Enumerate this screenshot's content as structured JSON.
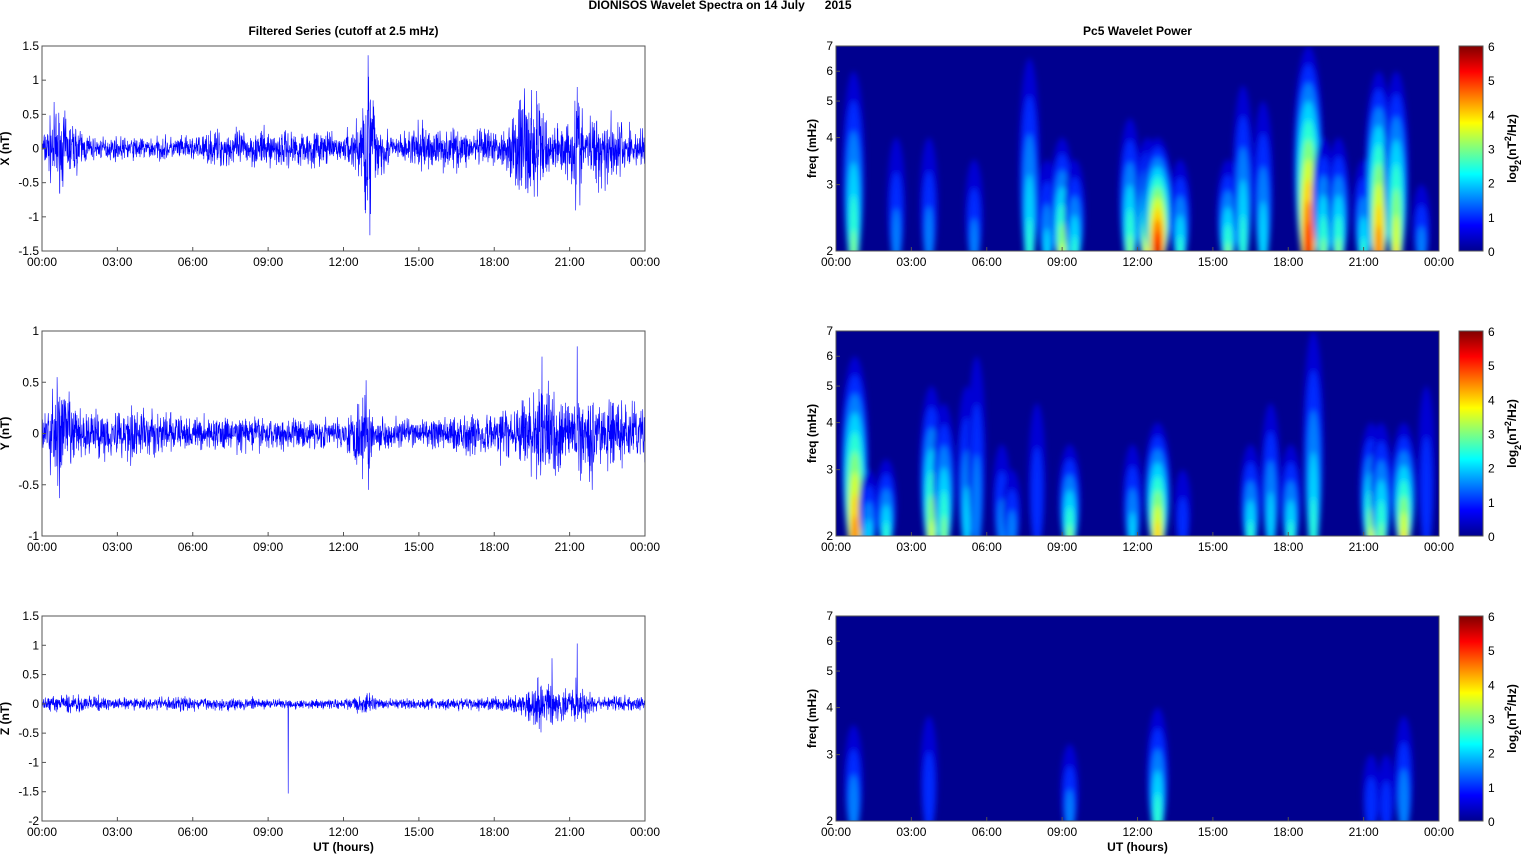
{
  "title": "DIONISOS Wavelet Spectra on 14 July      2015",
  "colors": {
    "trace": "#0000ff",
    "spec_background": "#00008f"
  },
  "chart_data": [
    {
      "type": "line",
      "panel": "X",
      "title": "Filtered Series (cutoff at 2.5 mHz)",
      "ylabel": "X (nT)",
      "xlabel": "",
      "ylim": [
        -1.5,
        1.5
      ],
      "yticks": [
        "-1.5",
        "-1",
        "-0.5",
        "0",
        "0.5",
        "1",
        "1.5"
      ],
      "xticks": [
        "00:00",
        "03:00",
        "06:00",
        "09:00",
        "12:00",
        "15:00",
        "18:00",
        "21:00",
        "00:00"
      ],
      "envelope": [
        [
          0,
          0.12
        ],
        [
          0.5,
          0.45
        ],
        [
          1.2,
          0.3
        ],
        [
          2,
          0.12
        ],
        [
          6,
          0.13
        ],
        [
          7,
          0.2
        ],
        [
          11,
          0.2
        ],
        [
          12,
          0.12
        ],
        [
          12.8,
          0.5
        ],
        [
          13,
          1.1
        ],
        [
          13.3,
          0.4
        ],
        [
          14,
          0.12
        ],
        [
          15,
          0.25
        ],
        [
          17,
          0.2
        ],
        [
          18.5,
          0.2
        ],
        [
          19,
          0.6
        ],
        [
          19.5,
          0.7
        ],
        [
          20.3,
          0.25
        ],
        [
          21,
          0.3
        ],
        [
          21.3,
          0.75
        ],
        [
          21.6,
          0.3
        ],
        [
          22.3,
          0.45
        ],
        [
          23,
          0.3
        ],
        [
          24,
          0.2
        ]
      ],
      "spikes": [
        [
          13.0,
          1.05
        ],
        [
          13.05,
          -1.27
        ],
        [
          19.2,
          0.88
        ],
        [
          21.3,
          0.9
        ]
      ]
    },
    {
      "type": "heatmap",
      "panel": "X",
      "title": "Pc5 Wavelet Power",
      "ylabel": "freq (mHz)",
      "colorbar_label": "log2(nT2/Hz)",
      "clim": [
        0,
        6
      ],
      "ylim": [
        2,
        7
      ],
      "yticks": [
        "2",
        "3",
        "4",
        "5",
        "6",
        "7"
      ],
      "cticks": [
        "0",
        "1",
        "2",
        "3",
        "4",
        "5",
        "6"
      ],
      "xticks": [
        "00:00",
        "03:00",
        "06:00",
        "09:00",
        "12:00",
        "15:00",
        "18:00",
        "21:00",
        "00:00"
      ],
      "blobs": [
        [
          0.7,
          2.7,
          3,
          6
        ],
        [
          2.4,
          2.6,
          1.5,
          4
        ],
        [
          3.7,
          2.8,
          1.5,
          4
        ],
        [
          5.5,
          2.4,
          1.5,
          3.5
        ],
        [
          7.7,
          2.7,
          2.5,
          6.5
        ],
        [
          8.4,
          2.5,
          2,
          3.5
        ],
        [
          9.0,
          2.6,
          3.5,
          4
        ],
        [
          9.5,
          2.5,
          2.5,
          3.5
        ],
        [
          11.7,
          2.7,
          3,
          4.5
        ],
        [
          12.4,
          2.5,
          4,
          4
        ],
        [
          12.8,
          2.6,
          6,
          4
        ],
        [
          13.7,
          2.5,
          2.5,
          3.5
        ],
        [
          15.6,
          2.4,
          3,
          3.5
        ],
        [
          16.2,
          3.3,
          2.5,
          5.5
        ],
        [
          17.0,
          2.8,
          2.2,
          5
        ],
        [
          18.8,
          2.7,
          5.8,
          7
        ],
        [
          19.4,
          2.6,
          3,
          4
        ],
        [
          20.0,
          2.6,
          3,
          4
        ],
        [
          21.0,
          2.4,
          2.5,
          3.5
        ],
        [
          21.6,
          3.0,
          5,
          6
        ],
        [
          22.3,
          2.8,
          4,
          6
        ],
        [
          23.3,
          2.5,
          1.5,
          3
        ]
      ]
    },
    {
      "type": "line",
      "panel": "Y",
      "title": "",
      "ylabel": "Y (nT)",
      "ylim": [
        -1,
        1
      ],
      "yticks": [
        "-1",
        "-0.5",
        "0",
        "0.5",
        "1"
      ],
      "xticks": [
        "00:00",
        "03:00",
        "06:00",
        "09:00",
        "12:00",
        "15:00",
        "18:00",
        "21:00",
        "00:00"
      ],
      "envelope": [
        [
          0,
          0.12
        ],
        [
          0.5,
          0.4
        ],
        [
          1,
          0.35
        ],
        [
          1.5,
          0.15
        ],
        [
          2.5,
          0.2
        ],
        [
          4,
          0.18
        ],
        [
          6,
          0.12
        ],
        [
          9,
          0.12
        ],
        [
          12,
          0.1
        ],
        [
          12.8,
          0.35
        ],
        [
          13.2,
          0.12
        ],
        [
          15,
          0.1
        ],
        [
          17,
          0.15
        ],
        [
          19,
          0.2
        ],
        [
          20,
          0.35
        ],
        [
          20.5,
          0.3
        ],
        [
          21,
          0.2
        ],
        [
          21.5,
          0.3
        ],
        [
          22.5,
          0.25
        ],
        [
          24,
          0.2
        ]
      ],
      "spikes": [
        [
          0.6,
          0.55
        ],
        [
          0.7,
          -0.63
        ],
        [
          12.9,
          0.52
        ],
        [
          13.0,
          -0.55
        ],
        [
          19.9,
          0.75
        ],
        [
          21.3,
          0.85
        ],
        [
          21.9,
          -0.55
        ]
      ]
    },
    {
      "type": "heatmap",
      "panel": "Y",
      "ylabel": "freq (mHz)",
      "colorbar_label": "log2(nT2/Hz)",
      "clim": [
        0,
        6
      ],
      "ylim": [
        2,
        7
      ],
      "yticks": [
        "2",
        "3",
        "4",
        "5",
        "6",
        "7"
      ],
      "cticks": [
        "0",
        "1",
        "2",
        "3",
        "4",
        "5",
        "6"
      ],
      "xticks": [
        "00:00",
        "03:00",
        "06:00",
        "09:00",
        "12:00",
        "15:00",
        "18:00",
        "21:00",
        "00:00"
      ],
      "blobs": [
        [
          0.75,
          2.6,
          5,
          6
        ],
        [
          1.3,
          2.5,
          2,
          3
        ],
        [
          2.0,
          2.6,
          2.5,
          3.2
        ],
        [
          3.8,
          3.0,
          3.5,
          5
        ],
        [
          4.3,
          3.0,
          3,
          4.5
        ],
        [
          5.2,
          3.8,
          2,
          5
        ],
        [
          5.6,
          4.6,
          1.5,
          6
        ],
        [
          6.6,
          2.8,
          1.5,
          3.5
        ],
        [
          7.0,
          2.6,
          1.5,
          3
        ],
        [
          8.0,
          3.6,
          1.2,
          4.5
        ],
        [
          9.3,
          2.6,
          3,
          3.5
        ],
        [
          11.8,
          2.6,
          2,
          3.5
        ],
        [
          12.8,
          2.4,
          4.5,
          4
        ],
        [
          13.8,
          2.6,
          1,
          3
        ],
        [
          16.5,
          2.5,
          2.5,
          3.5
        ],
        [
          17.3,
          3.6,
          2,
          4.5
        ],
        [
          18.1,
          2.5,
          2.5,
          3.5
        ],
        [
          19.0,
          3.0,
          2.5,
          7
        ],
        [
          21.3,
          2.6,
          3.5,
          4
        ],
        [
          21.7,
          2.6,
          3,
          4
        ],
        [
          22.6,
          2.7,
          4,
          4
        ],
        [
          23.5,
          3.6,
          1.2,
          5
        ]
      ]
    },
    {
      "type": "line",
      "panel": "Z",
      "title": "",
      "ylabel": "Z (nT)",
      "xlabel": "UT (hours)",
      "ylim": [
        -2,
        1.5
      ],
      "yticks": [
        "-2",
        "-1.5",
        "-1",
        "-0.5",
        "0",
        "0.5",
        "1",
        "1.5"
      ],
      "xticks": [
        "00:00",
        "03:00",
        "06:00",
        "09:00",
        "12:00",
        "15:00",
        "18:00",
        "21:00",
        "00:00"
      ],
      "envelope": [
        [
          0,
          0.08
        ],
        [
          1,
          0.12
        ],
        [
          3,
          0.07
        ],
        [
          6,
          0.09
        ],
        [
          9,
          0.07
        ],
        [
          12,
          0.06
        ],
        [
          13,
          0.15
        ],
        [
          13.5,
          0.06
        ],
        [
          18,
          0.08
        ],
        [
          19,
          0.12
        ],
        [
          19.8,
          0.3
        ],
        [
          20.5,
          0.25
        ],
        [
          21,
          0.15
        ],
        [
          21.3,
          0.3
        ],
        [
          22,
          0.1
        ],
        [
          24,
          0.08
        ]
      ],
      "spikes": [
        [
          9.8,
          -1.53
        ],
        [
          20.3,
          0.78
        ],
        [
          21.3,
          1.03
        ]
      ]
    },
    {
      "type": "heatmap",
      "panel": "Z",
      "ylabel": "freq (mHz)",
      "xlabel": "UT (hours)",
      "colorbar_label": "log2(nT2/Hz)",
      "clim": [
        0,
        6
      ],
      "ylim": [
        2,
        7
      ],
      "yticks": [
        "2",
        "3",
        "4",
        "5",
        "6",
        "7"
      ],
      "cticks": [
        "0",
        "1",
        "2",
        "3",
        "4",
        "5",
        "6"
      ],
      "xticks": [
        "00:00",
        "03:00",
        "06:00",
        "09:00",
        "12:00",
        "15:00",
        "18:00",
        "21:00",
        "00:00"
      ],
      "blobs": [
        [
          0.7,
          2.7,
          1.8,
          3.6
        ],
        [
          3.7,
          3.1,
          1.2,
          3.8
        ],
        [
          9.3,
          2.8,
          1.5,
          3.2
        ],
        [
          12.8,
          2.4,
          2.8,
          4
        ],
        [
          21.3,
          2.8,
          1.2,
          3
        ],
        [
          21.9,
          2.8,
          1,
          3
        ],
        [
          22.6,
          2.9,
          1.8,
          3.8
        ]
      ]
    }
  ]
}
